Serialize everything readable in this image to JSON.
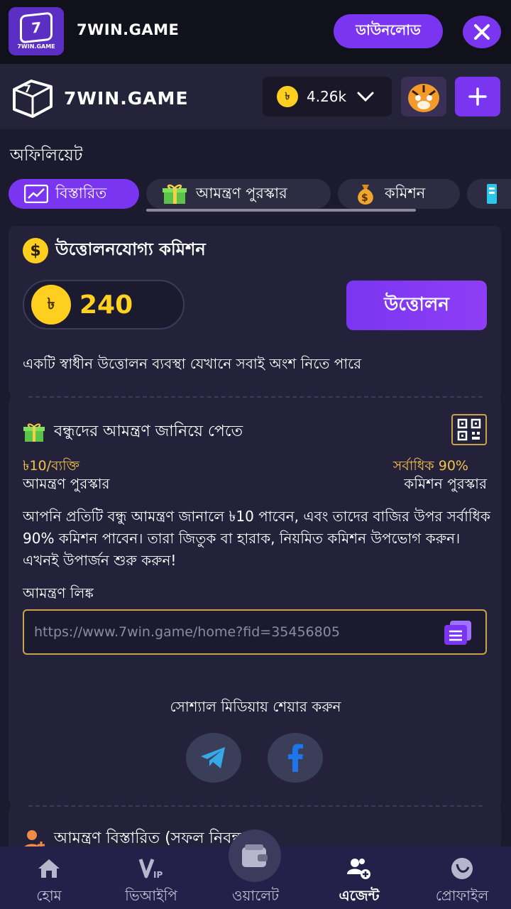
{
  "banner": {
    "brand": "7WIN.GAME",
    "logo_text": "7WIN.GAME",
    "download_label": "ডাউনলোড"
  },
  "header": {
    "brand": "7WIN.GAME",
    "currency_symbol": "৳",
    "balance": "4.26k"
  },
  "page": {
    "title": "অফিলিয়েট"
  },
  "tabs": [
    {
      "label": "বিস্তারিত",
      "active": true,
      "icon": "chart-icon"
    },
    {
      "label": "আমন্ত্রণ পুরস্কার",
      "active": false,
      "icon": "gift-icon"
    },
    {
      "label": "কমিশন",
      "active": false,
      "icon": "money-bag-icon"
    }
  ],
  "withdraw": {
    "title": "উত্তোলনযোগ্য কমিশন",
    "dollar_symbol": "$",
    "currency_symbol": "৳",
    "amount": "240",
    "button_label": "উত্তোলন",
    "description": "একটি স্বাধীন উত্তোলন ব্যবস্থা যেখানে সবাই অংশ নিতে পারে"
  },
  "invite": {
    "title": "বন্ধুদের আমন্ত্রণ জানিয়ে পেতে",
    "reward_value": "৳10/ব্যক্তি",
    "reward_label": "আমন্ত্রণ পুরস্কার",
    "commission_value": "সর্বাধিক 90%",
    "commission_label": "কমিশন পুরস্কার",
    "description": "আপনি প্রতিটি বন্ধু আমন্ত্রণ জানালে ৳10 পাবেন, এবং তাদের বাজির উপর সর্বাধিক 90% কমিশন পাবেন। তারা জিতুক বা হারাক, নিয়মিত কমিশন উপভোগ করুন। এখনই উপার্জন শুরু করুন!",
    "link_label": "আমন্ত্রণ লিঙ্ক",
    "link_value": "https://www.7win.game/home?fid=35456805",
    "share_title": "সোশ্যাল মিডিয়ায় শেয়ার করুন"
  },
  "details": {
    "title": "আমন্ত্রণ বিস্তারিত (সফল নিবন্ধন)"
  },
  "nav": [
    {
      "label": "হোম",
      "icon": "home-icon"
    },
    {
      "label": "ভিআইপি",
      "icon": "vip-icon"
    },
    {
      "label": "ওয়ালেট",
      "icon": "wallet-icon"
    },
    {
      "label": "এজেন্ট",
      "icon": "agent-icon",
      "active": true
    },
    {
      "label": "প্রোফাইল",
      "icon": "profile-icon"
    }
  ],
  "colors": {
    "background": "#1c1a2e",
    "card": "#24223a",
    "accent": "#7a35f0",
    "gold": "#ffd21f",
    "highlight_text": "#f2c24a"
  }
}
